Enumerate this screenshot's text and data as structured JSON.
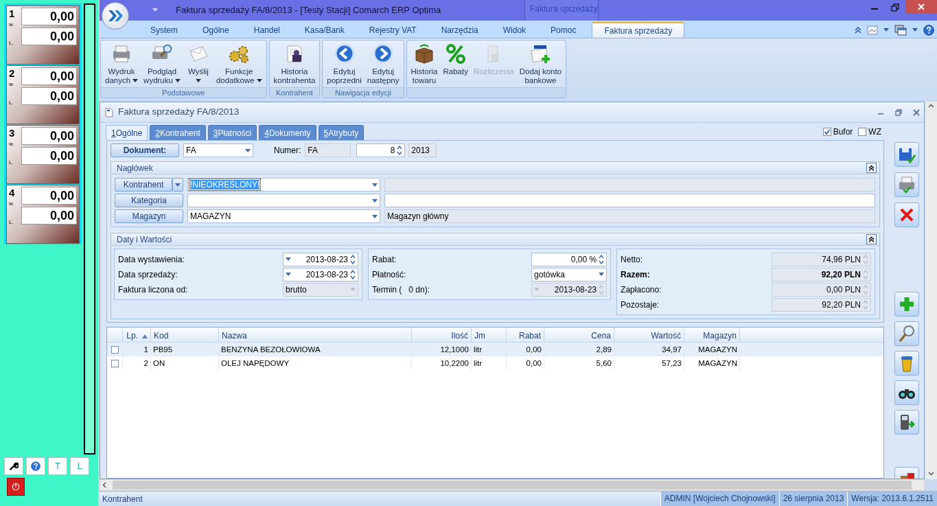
{
  "left_panel": {
    "stations": [
      {
        "number": "1",
        "w_label": "w.",
        "l_label": "L.",
        "w_value": "0,00",
        "l_value": "0,00"
      },
      {
        "number": "2",
        "w_label": "w.",
        "l_label": "L.",
        "w_value": "0,00",
        "l_value": "0,00"
      },
      {
        "number": "3",
        "w_label": "w.",
        "l_label": "L.",
        "w_value": "0,00",
        "l_value": "0,00"
      },
      {
        "number": "4",
        "w_label": "w.",
        "l_label": "L.",
        "w_value": "0,00",
        "l_value": "0,00"
      }
    ],
    "tools": [
      {
        "kind": "wrench"
      },
      {
        "kind": "help"
      },
      {
        "kind": "text",
        "label": "T"
      },
      {
        "kind": "text",
        "label": "L"
      },
      {
        "kind": "power"
      }
    ]
  },
  "window": {
    "title": "Faktura sprzedaży FA/8/2013 - [Testy Stacji] Comarch ERP Optima",
    "context_group": "Faktura sprzedaży"
  },
  "ribbon": {
    "tabs": [
      {
        "label": "System",
        "selected": false
      },
      {
        "label": "Ogólne",
        "selected": false
      },
      {
        "label": "Handel",
        "selected": false
      },
      {
        "label": "Kasa/Bank",
        "selected": false
      },
      {
        "label": "Rejestry VAT",
        "selected": false
      },
      {
        "label": "Narzędzia",
        "selected": false
      },
      {
        "label": "Widok",
        "selected": false
      },
      {
        "label": "Pomoc",
        "selected": false
      },
      {
        "label": "Faktura sprzedaży",
        "selected": true
      }
    ],
    "groups": [
      {
        "label": "Podstawowe",
        "buttons": [
          {
            "lines": [
              "Wydruk",
              "danych"
            ],
            "dropdown": true,
            "disabled": false
          },
          {
            "lines": [
              "Podgląd",
              "wydruku"
            ],
            "dropdown": true,
            "disabled": false
          },
          {
            "lines": [
              "Wyślij"
            ],
            "dropdown": true,
            "disabled": false
          },
          {
            "lines": [
              "Funkcje",
              "dodatkowe"
            ],
            "dropdown": true,
            "disabled": false
          }
        ]
      },
      {
        "label": "Kontrahent",
        "buttons": [
          {
            "lines": [
              "Historia",
              "kontrahenta"
            ],
            "dropdown": false,
            "disabled": false
          }
        ]
      },
      {
        "label": "Nawigacja edycji",
        "buttons": [
          {
            "lines": [
              "Edytuj",
              "poprzedni"
            ],
            "dropdown": false,
            "disabled": false
          },
          {
            "lines": [
              "Edytuj",
              "następny"
            ],
            "dropdown": false,
            "disabled": false
          }
        ]
      },
      {
        "buttons": [
          {
            "lines": [
              "Historia",
              "towaru"
            ],
            "dropdown": false,
            "disabled": false
          },
          {
            "lines": [
              "Rabaty"
            ],
            "dropdown": false,
            "disabled": false
          },
          {
            "lines": [
              "Rozliczenia"
            ],
            "dropdown": false,
            "disabled": true
          },
          {
            "lines": [
              "Dodaj konto",
              "bankowe"
            ],
            "dropdown": false,
            "disabled": false
          }
        ]
      }
    ]
  },
  "document": {
    "title": "Faktura sprzedaży FA/8/2013",
    "tabs": [
      {
        "key": "1",
        "label": "Ogólne",
        "selected": true
      },
      {
        "key": "2",
        "label": "Kontrahent",
        "selected": false
      },
      {
        "key": "3",
        "label": "Płatności",
        "selected": false
      },
      {
        "key": "4",
        "label": "Dokumenty",
        "selected": false
      },
      {
        "key": "5",
        "label": "Atrybuty",
        "selected": false
      }
    ],
    "flags": [
      {
        "label": "Bufor",
        "checked": true
      },
      {
        "label": "WZ",
        "checked": false
      }
    ],
    "header_row": {
      "button": "Dokument:",
      "type": {
        "kind": "combo",
        "value": "FA",
        "disabled": false
      },
      "number_label": "Numer:",
      "number_fields": [
        {
          "kind": "text",
          "value": "FA",
          "disabled": true
        },
        {
          "kind": "spin",
          "value": "8",
          "disabled": false
        },
        {
          "kind": "text",
          "value": "2013",
          "disabled": true
        }
      ]
    },
    "naglowek": {
      "title": "Nagłówek",
      "expanded": true,
      "rows": [
        {
          "button": "Kontrahent",
          "split": true,
          "value": "!NIEOKREŚLONY!",
          "highlighted": true,
          "description_disabled": true
        },
        {
          "button": "Kategoria",
          "split": false,
          "highlighted": false,
          "description_disabled": false
        },
        {
          "button": "Magazyn",
          "split": false,
          "value": "MAGAZYN",
          "highlighted": false,
          "description": "Magazyn główny",
          "description_disabled": true
        }
      ]
    },
    "daty": {
      "title": "Daty i Wartości",
      "expanded": true,
      "columns": [
        [
          {
            "label": "Data wystawienia:",
            "kind": "date",
            "value": "2013-08-23",
            "disabled": false,
            "bold": false
          },
          {
            "label": "Data sprzedaży:",
            "kind": "date",
            "value": "2013-08-23",
            "disabled": false,
            "bold": false
          },
          {
            "label": "Faktura liczona od:",
            "kind": "combo",
            "value": "brutto",
            "disabled": true,
            "bold": false
          }
        ],
        [
          {
            "label": "Rabat:",
            "kind": "spin",
            "value": "0,00 %",
            "disabled": false,
            "bold": false
          },
          {
            "label": "Płatność:",
            "kind": "combo",
            "value": "gotówka",
            "disabled": false,
            "bold": false
          },
          {
            "label": "Termin (   0 dn):",
            "kind": "date",
            "value": "2013-08-23",
            "disabled": true,
            "bold": false
          }
        ],
        [
          {
            "label": "Netto:",
            "kind": "spin",
            "value": "74,96 PLN",
            "disabled": true,
            "bold": false
          },
          {
            "label": "Razem:",
            "kind": "spin",
            "value": "92,20 PLN",
            "disabled": true,
            "bold": true
          },
          {
            "label": "Zapłacono:",
            "kind": "spin",
            "value": "0,00 PLN",
            "disabled": true,
            "bold": false
          },
          {
            "label": "Pozostaje:",
            "kind": "spin",
            "value": "92,20 PLN",
            "disabled": true,
            "bold": false
          }
        ]
      ]
    },
    "table": {
      "columns": [
        {
          "label": "Lp.",
          "sorted": true
        },
        {
          "label": "Kod",
          "sorted": false
        },
        {
          "label": "Nazwa",
          "sorted": false
        },
        {
          "label": "Ilość",
          "sorted": false
        },
        {
          "label": "Jm",
          "sorted": false
        },
        {
          "label": "Rabat",
          "sorted": false
        },
        {
          "label": "Cena",
          "sorted": false
        },
        {
          "label": "Wartość",
          "sorted": false
        },
        {
          "label": "Magazyn",
          "sorted": false
        }
      ],
      "rows": [
        {
          "checked": false,
          "selected": true,
          "cells": [
            "1",
            "PB95",
            "BENZYNA BEZOŁOWIOWA",
            "12,1000",
            "litr",
            "0,00",
            "2,89",
            "34,97",
            "MAGAZYN"
          ]
        },
        {
          "checked": false,
          "selected": false,
          "cells": [
            "2",
            "ON",
            "OLEJ NAPĘDOWY",
            "10,2200",
            "litr",
            "0,00",
            "5,60",
            "57,23",
            "MAGAZYN"
          ]
        }
      ]
    }
  },
  "status_bar": {
    "hint": "Kontrahent",
    "user": "ADMIN [Wojciech Chojnowski]",
    "date": "26 sierpnia 2013",
    "version": "Wersja: 2013.6.1.2511"
  }
}
